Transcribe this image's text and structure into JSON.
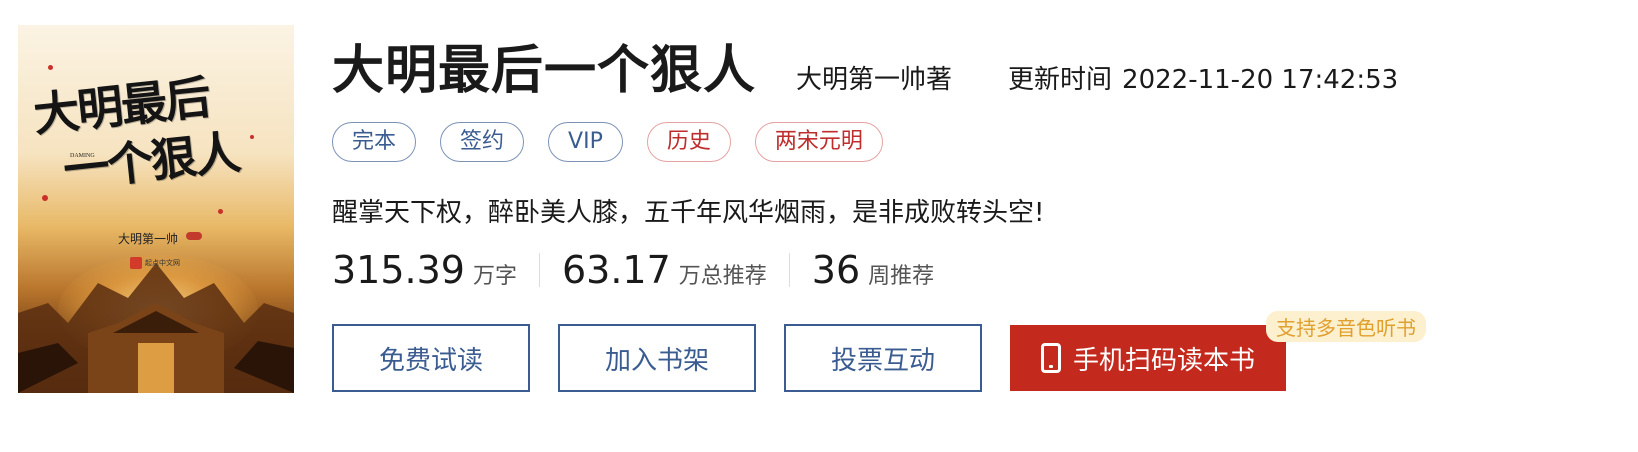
{
  "cover": {
    "title_line1": "大明最后",
    "title_line2": "一个狠人",
    "latin_caption": "DAMING",
    "author": "大明第一帅",
    "publisher": "起点中文网"
  },
  "book": {
    "title": "大明最后一个狠人",
    "author": "大明第一帅著",
    "update_label": "更新时间",
    "update_time": "2022-11-20 17:42:53",
    "intro": "醒掌天下权，醉卧美人膝，五千年风华烟雨，是非成败转头空!"
  },
  "tags": [
    {
      "label": "完本",
      "style": "blue"
    },
    {
      "label": "签约",
      "style": "blue"
    },
    {
      "label": "VIP",
      "style": "blue"
    },
    {
      "label": "历史",
      "style": "red"
    },
    {
      "label": "两宋元明",
      "style": "red"
    }
  ],
  "stats": [
    {
      "value": "315.39",
      "unit": "万字"
    },
    {
      "value": "63.17",
      "unit": "万总推荐"
    },
    {
      "value": "36",
      "unit": "周推荐"
    }
  ],
  "actions": {
    "read_free": "免费试读",
    "add_shelf": "加入书架",
    "vote": "投票互动",
    "scan": "手机扫码读本书",
    "audio_badge": "支持多音色听书"
  },
  "colors": {
    "accent_blue": "#3b5c91",
    "accent_red": "#c4291d",
    "badge_bg": "#fdf0cf",
    "badge_text": "#e0a02e"
  }
}
